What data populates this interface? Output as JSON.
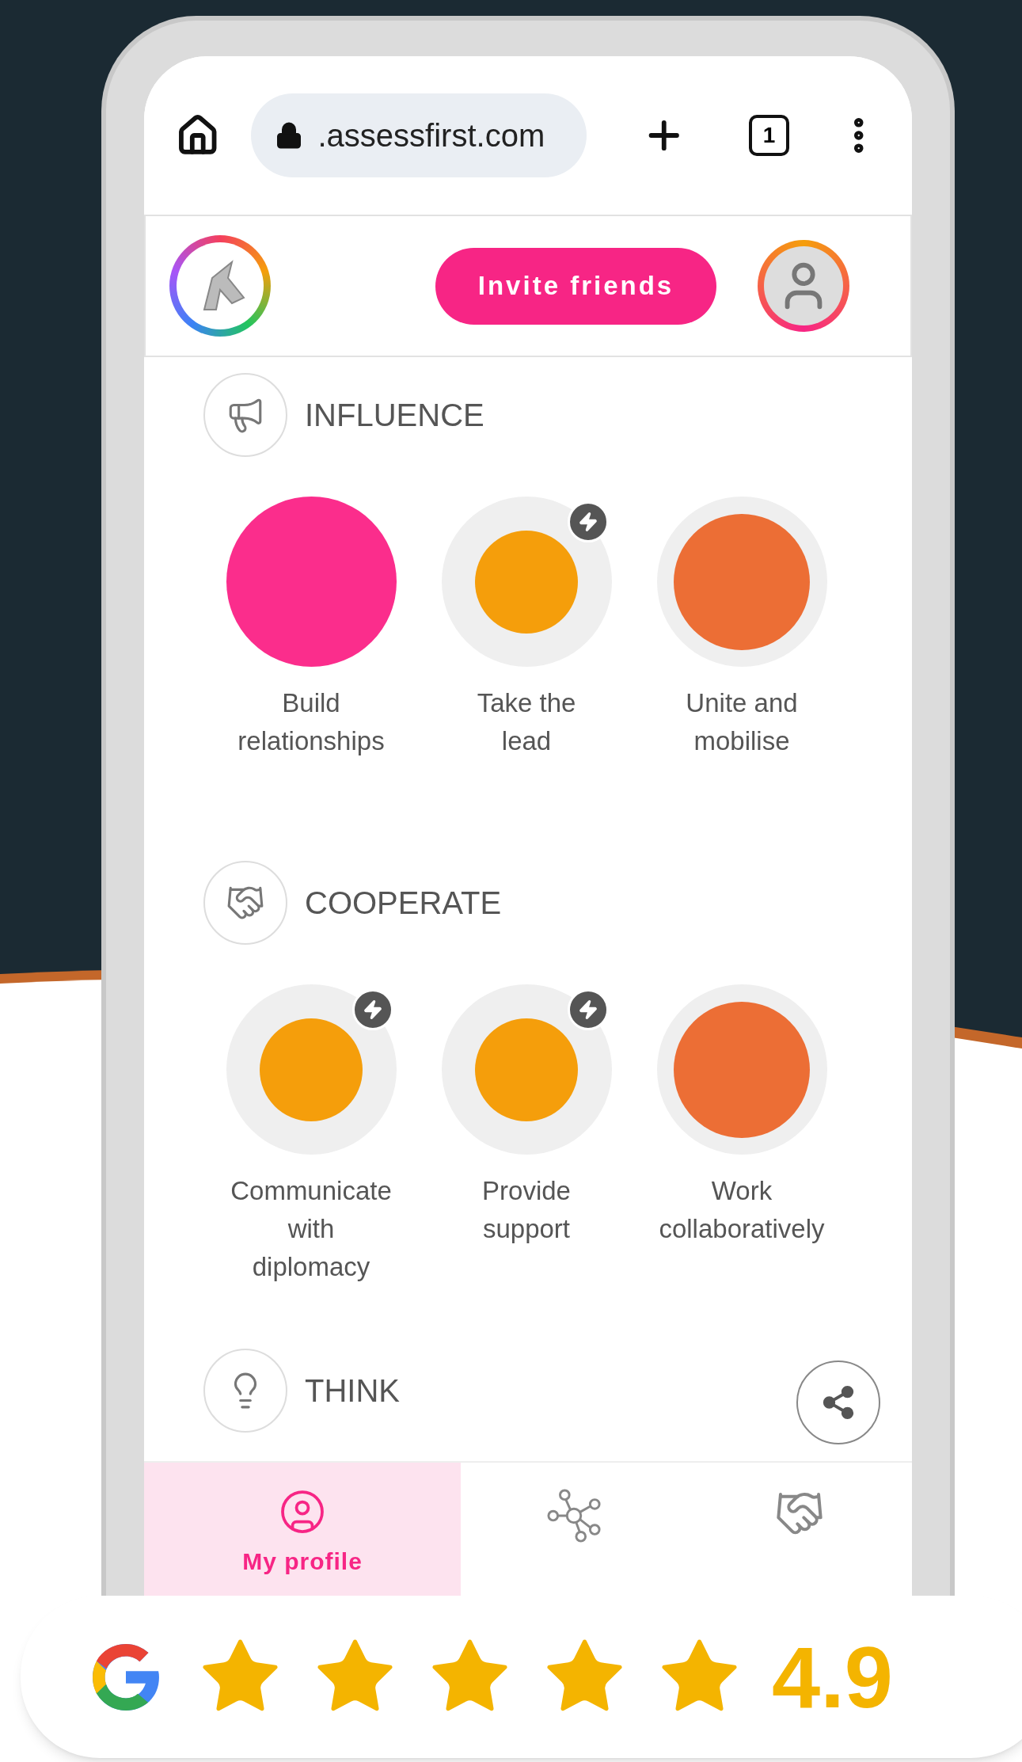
{
  "browser": {
    "url": ".assessfirst.com",
    "tab_count": "1"
  },
  "header": {
    "invite_button": "Invite friends"
  },
  "sections": [
    {
      "title": "INFLUENCE",
      "traits": [
        {
          "label": "Build\nrelationships",
          "kind": "full",
          "color": "#fb2d8c",
          "boosted": false
        },
        {
          "label": "Take the\nlead",
          "kind": "small",
          "color": "#f59e0b",
          "boosted": true
        },
        {
          "label": "Unite and\nmobilise",
          "kind": "large",
          "color": "#ec6e35",
          "boosted": false
        }
      ]
    },
    {
      "title": "COOPERATE",
      "traits": [
        {
          "label": "Communicate\nwith\ndiplomacy",
          "kind": "small",
          "color": "#f59e0b",
          "boosted": true
        },
        {
          "label": "Provide\nsupport",
          "kind": "small",
          "color": "#f59e0b",
          "boosted": true
        },
        {
          "label": "Work\ncollaboratively",
          "kind": "large",
          "color": "#ec6e35",
          "boosted": false
        }
      ]
    },
    {
      "title": "THINK"
    }
  ],
  "nav": [
    {
      "label": "My profile",
      "selected": true
    },
    {
      "selected": false
    },
    {
      "selected": false
    }
  ],
  "rating": {
    "stars": 5,
    "value": "4.9"
  }
}
